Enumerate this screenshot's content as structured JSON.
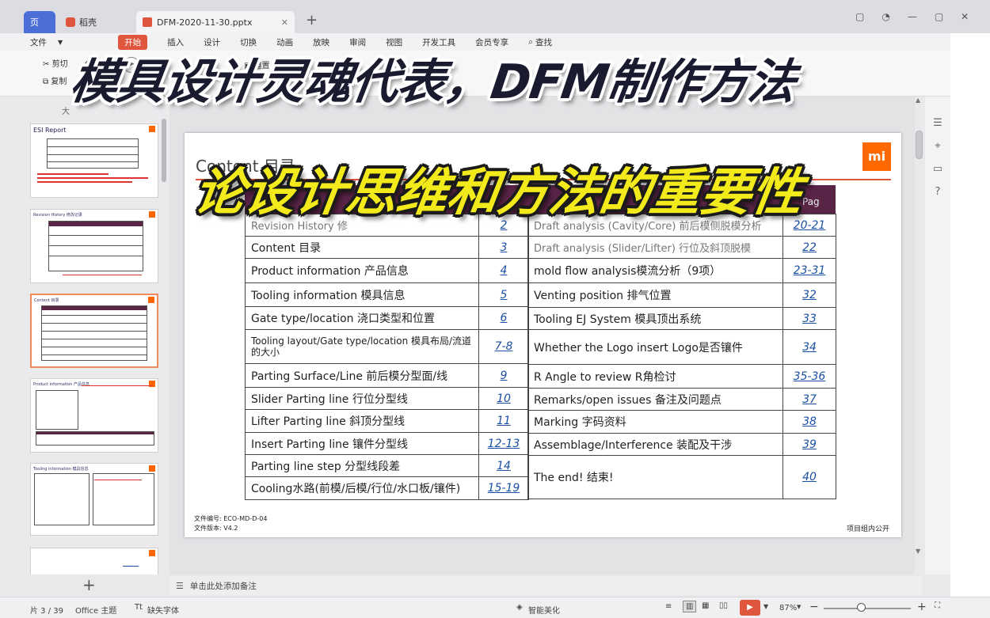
{
  "colors": {
    "accent": "#e0553d",
    "slide_header_fill": "#5a2447",
    "link": "#1a4fa3",
    "overlay_yellow": "#f3ea1c",
    "brand_orange": "#ff6900"
  },
  "tabs": {
    "home": "页",
    "wps": "稻壳",
    "doc": "DFM-2020-11-30.pptx"
  },
  "menu": {
    "file": "文件",
    "items": [
      "开始",
      "插入",
      "设计",
      "切换",
      "动画",
      "放映",
      "审阅",
      "视图",
      "开发工具",
      "会员专享"
    ],
    "search": "查找"
  },
  "ribbon": {
    "cut": "剪切",
    "copy": "复制",
    "reset": "重置"
  },
  "overlay": {
    "line1": "模具设计灵魂代表，DFM制作方法",
    "line2": "论设计思维和方法的重要性"
  },
  "slide": {
    "title": "Content 目录",
    "logo": "mi",
    "left_rows": [
      {
        "label": "Revision History 修",
        "page": "2"
      },
      {
        "label": "Content 目录",
        "page": "3"
      },
      {
        "label": "Product  information 产品信息",
        "page": "4"
      },
      {
        "label": "Tooling  information 模具信息",
        "page": "5"
      },
      {
        "label": "Gate type/location 浇口类型和位置",
        "page": "6"
      },
      {
        "label": "Tooling layout/Gate type/location  模具布局/流道的大小",
        "page": "7-8"
      },
      {
        "label": "Parting Surface/Line 前后模分型面/线",
        "page": "9"
      },
      {
        "label": "Slider Parting line 行位分型线",
        "page": "10"
      },
      {
        "label": "Lifter Parting line 斜顶分型线",
        "page": "11"
      },
      {
        "label": "Insert Parting line 镶件分型线",
        "page": "12-13"
      },
      {
        "label": "Parting line step 分型线段差",
        "page": "14"
      },
      {
        "label": "Cooling水路(前模/后模/行位/水口板/镶件)",
        "page": "15-19"
      }
    ],
    "right_rows": [
      {
        "label": "Draft analysis (Cavity/Core) 前后模侧脱模分析",
        "page": "20-21"
      },
      {
        "label": "Draft analysis (Slider/Lifter) 行位及斜顶脱模",
        "page": "22"
      },
      {
        "label": "mold flow analysis模流分析（9项）",
        "page": "23-31"
      },
      {
        "label": "Venting position 排气位置",
        "page": "32"
      },
      {
        "label": "Tooling EJ System 模具顶出系统",
        "page": "33"
      },
      {
        "label": "Whether the Logo insert Logo是否镶件",
        "page": "34"
      },
      {
        "label": "R Angle to review R角检讨",
        "page": "35-36"
      },
      {
        "label": "Remarks/open issues 备注及问题点",
        "page": "37"
      },
      {
        "label": "Marking 字码资料",
        "page": "38"
      },
      {
        "label": "Assemblage/Interference 装配及干涉",
        "page": "39"
      },
      {
        "label": "The end! 结束!",
        "page": "40"
      }
    ],
    "page_header": "Pag",
    "footer_doc": "文件编号:  ECO-MD-D-04",
    "footer_ver": "文件版本:  V4.2",
    "footer_right": "项目组内公开"
  },
  "thumbs": {
    "t1_title": "ESI Report",
    "t2_title": "Revision History 修改记录",
    "t3_title": "Content 目录",
    "t4_title": "Product information 产品信息",
    "t5_title": "Tooling information 模具信息"
  },
  "notes_placeholder": "单击此处添加备注",
  "status": {
    "page": "片 3 / 39",
    "theme": "Office 主题",
    "font": "缺失字体",
    "beautify": "智能美化",
    "zoom": "87%"
  }
}
